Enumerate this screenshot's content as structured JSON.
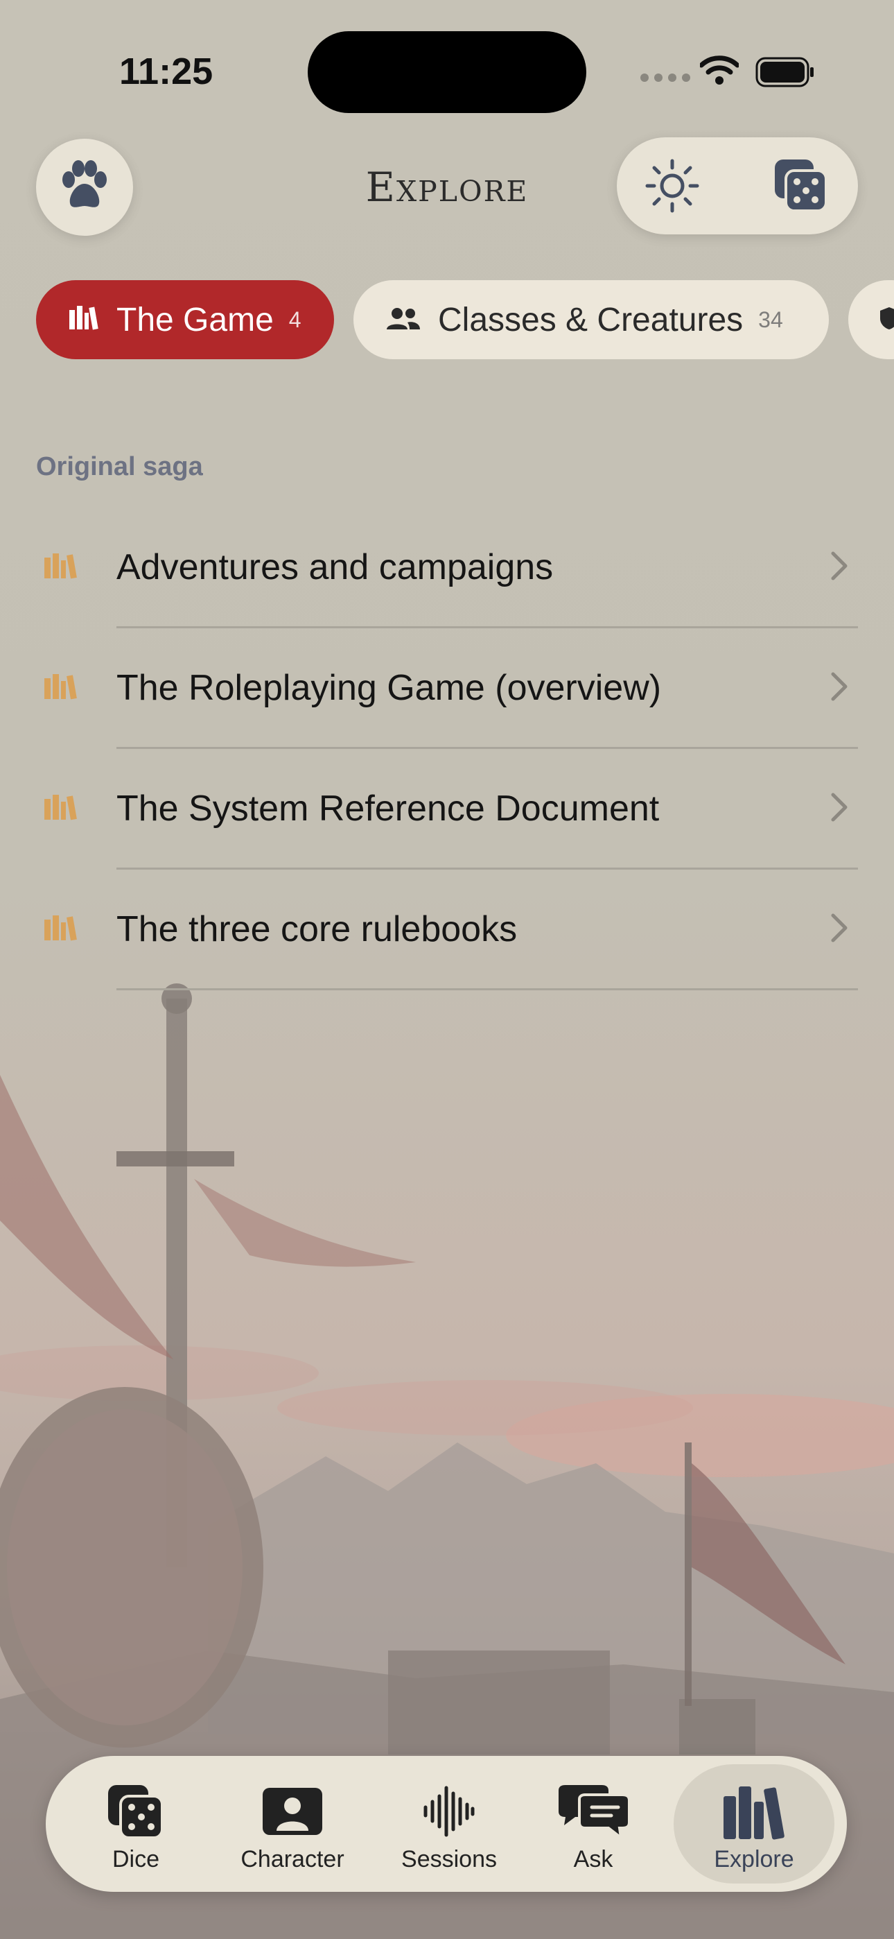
{
  "status_bar": {
    "time": "11:25"
  },
  "header": {
    "title": "Explore",
    "left_icon": "paw-icon",
    "right_icons": [
      "sun-icon",
      "dice-icon"
    ]
  },
  "chips": [
    {
      "label": "The Game",
      "count": "4",
      "icon": "books-icon",
      "active": true,
      "color": "#b1282a"
    },
    {
      "label": "Classes & Creatures",
      "count": "34",
      "icon": "people-icon",
      "active": false
    },
    {
      "label": "",
      "count": "",
      "icon": "shield-icon",
      "active": false
    }
  ],
  "section": {
    "title": "Original saga",
    "items": [
      {
        "label": "Adventures and campaigns",
        "icon": "books-icon"
      },
      {
        "label": "The Roleplaying Game (overview)",
        "icon": "books-icon"
      },
      {
        "label": "The System Reference Document",
        "icon": "books-icon"
      },
      {
        "label": "The three core rulebooks",
        "icon": "books-icon"
      }
    ],
    "icon_color": "#d9a25a"
  },
  "tabbar": {
    "tabs": [
      {
        "label": "Dice",
        "icon": "dice-icon"
      },
      {
        "label": "Character",
        "icon": "character-card-icon"
      },
      {
        "label": "Sessions",
        "icon": "waveform-icon"
      },
      {
        "label": "Ask",
        "icon": "chat-bubbles-icon"
      },
      {
        "label": "Explore",
        "icon": "books-icon",
        "active": true
      }
    ]
  },
  "colors": {
    "accent": "#b1282a",
    "tab_active": "#3a4358"
  }
}
